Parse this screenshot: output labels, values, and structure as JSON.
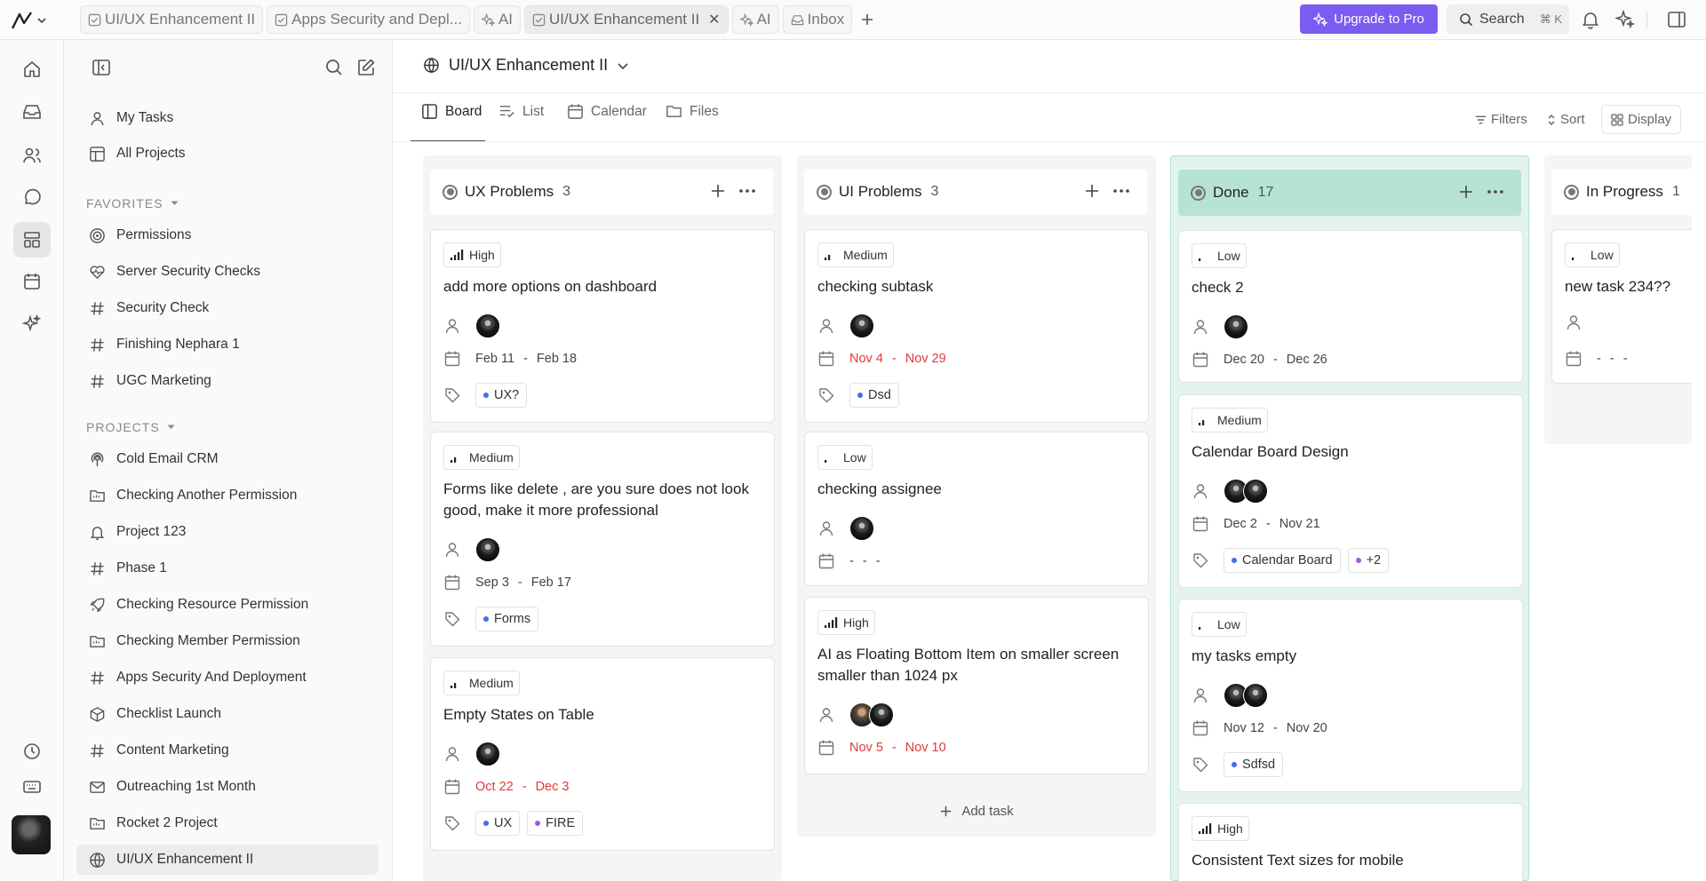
{
  "tabs": [
    {
      "label": "UI/UX Enhancement II",
      "icon": "checkbox-icon",
      "active": false
    },
    {
      "label": "Apps Security and Depl...",
      "icon": "checkbox-icon",
      "active": false
    },
    {
      "label": "AI",
      "icon": "sparkles-icon",
      "active": false
    },
    {
      "label": "UI/UX Enhancement II",
      "icon": "checkbox-icon",
      "active": true
    },
    {
      "label": "AI",
      "icon": "sparkles-icon",
      "active": false
    },
    {
      "label": "Inbox",
      "icon": "inbox-icon",
      "active": false
    }
  ],
  "topbar": {
    "upgrade_label": "Upgrade to Pro",
    "search_label": "Search",
    "search_shortcut": "⌘ K",
    "upgrade_color": "#7c5cf0"
  },
  "sidebar": {
    "top_items": [
      {
        "label": "My Tasks",
        "icon": "user-icon"
      },
      {
        "label": "All Projects",
        "icon": "layout-icon"
      }
    ],
    "favorites_label": "FAVORITES",
    "favorites": [
      {
        "label": "Permissions",
        "icon": "target-icon"
      },
      {
        "label": "Server Security Checks",
        "icon": "heart-pulse-icon"
      },
      {
        "label": "Security Check",
        "icon": "hash-icon"
      },
      {
        "label": "Finishing Nephara 1",
        "icon": "hash-icon"
      },
      {
        "label": "UGC Marketing",
        "icon": "hash-icon"
      }
    ],
    "projects_label": "PROJECTS",
    "projects": [
      {
        "label": "Cold Email CRM",
        "icon": "podcast-icon"
      },
      {
        "label": "Checking Another Permission",
        "icon": "folder-icon"
      },
      {
        "label": "Project 123",
        "icon": "bell-icon"
      },
      {
        "label": "Phase 1",
        "icon": "hash-icon"
      },
      {
        "label": "Checking Resource Permission",
        "icon": "rocket-icon"
      },
      {
        "label": "Checking Member Permission",
        "icon": "folder-icon"
      },
      {
        "label": "Apps Security And Deployment",
        "icon": "hash-icon"
      },
      {
        "label": "Checklist Launch",
        "icon": "box-icon"
      },
      {
        "label": "Content Marketing",
        "icon": "hash-icon"
      },
      {
        "label": "Outreaching 1st Month",
        "icon": "mail-icon"
      },
      {
        "label": "Rocket 2 Project",
        "icon": "folder-icon"
      },
      {
        "label": "UI/UX Enhancement II",
        "icon": "globe-icon",
        "active": true
      }
    ]
  },
  "project": {
    "title": "UI/UX Enhancement II",
    "views": [
      {
        "label": "Board",
        "icon": "board-icon",
        "active": true
      },
      {
        "label": "List",
        "icon": "list-icon",
        "active": false
      },
      {
        "label": "Calendar",
        "icon": "calendar-icon",
        "active": false
      },
      {
        "label": "Files",
        "icon": "folder-icon",
        "active": false
      }
    ],
    "tools": {
      "filters": "Filters",
      "sort": "Sort",
      "display": "Display"
    }
  },
  "board": {
    "add_task_label": "Add task",
    "columns": [
      {
        "name": "UX Problems",
        "count": "3",
        "cards": [
          {
            "priority": "High",
            "title": "add more options on dashboard",
            "assignees": 1,
            "start": "Feb 11",
            "end": "Feb 18",
            "overdue": false,
            "tags": [
              {
                "label": "UX?",
                "color": "#3b6ff0"
              }
            ]
          },
          {
            "priority": "Medium",
            "title": "Forms like delete , are you sure does not look good, make it more professional",
            "assignees": 1,
            "start": "Sep 3",
            "end": "Feb 17",
            "overdue": false,
            "tags": [
              {
                "label": "Forms",
                "color": "#3b6ff0"
              }
            ]
          },
          {
            "priority": "Medium",
            "title": "Empty States on Table",
            "assignees": 1,
            "start": "Oct 22",
            "end": "Dec 3",
            "overdue": true,
            "tags": [
              {
                "label": "UX",
                "color": "#3b6ff0"
              },
              {
                "label": "FIRE",
                "color": "#a05ae0"
              }
            ]
          }
        ]
      },
      {
        "name": "UI Problems",
        "count": "3",
        "cards": [
          {
            "priority": "Medium",
            "title": "checking subtask",
            "assignees": 1,
            "start": "Nov 4",
            "end": "Nov 29",
            "overdue": true,
            "tags": [
              {
                "label": "Dsd",
                "color": "#3b6ff0"
              }
            ]
          },
          {
            "priority": "Low",
            "title": "checking assignee",
            "assignees": 1,
            "start": "-",
            "end": "-",
            "overdue": false,
            "tags": []
          },
          {
            "priority": "High",
            "title": "AI as Floating Bottom Item on smaller screen smaller than 1024 px",
            "assignees": 2,
            "start": "Nov 5",
            "end": "Nov 10",
            "overdue": true,
            "tags": []
          }
        ]
      },
      {
        "name": "Done",
        "count": "17",
        "cards": [
          {
            "priority": "Low",
            "title": "check 2",
            "assignees": 1,
            "start": "Dec 20",
            "end": "Dec 26",
            "overdue": false,
            "tags": []
          },
          {
            "priority": "Medium",
            "title": "Calendar Board Design",
            "assignees": 2,
            "start": "Dec 2",
            "end": "Nov 21",
            "overdue": false,
            "tags": [
              {
                "label": "Calendar Board",
                "color": "#3b6ff0"
              },
              {
                "label": "+2",
                "color": "#a05ae0"
              }
            ]
          },
          {
            "priority": "Low",
            "title": "my tasks empty",
            "assignees": 2,
            "start": "Nov 12",
            "end": "Nov 20",
            "overdue": false,
            "tags": [
              {
                "label": "Sdfsd",
                "color": "#3b6ff0"
              }
            ]
          },
          {
            "priority": "High",
            "title": "Consistent Text sizes for mobile",
            "assignees": 0,
            "start": "",
            "end": "",
            "overdue": false,
            "tags": []
          }
        ]
      },
      {
        "name": "In Progress",
        "count": "1",
        "cards": [
          {
            "priority": "Low",
            "title": "new task 234??",
            "assignees": 0,
            "start": "-",
            "end": "-",
            "overdue": false,
            "tags": []
          }
        ]
      }
    ]
  }
}
